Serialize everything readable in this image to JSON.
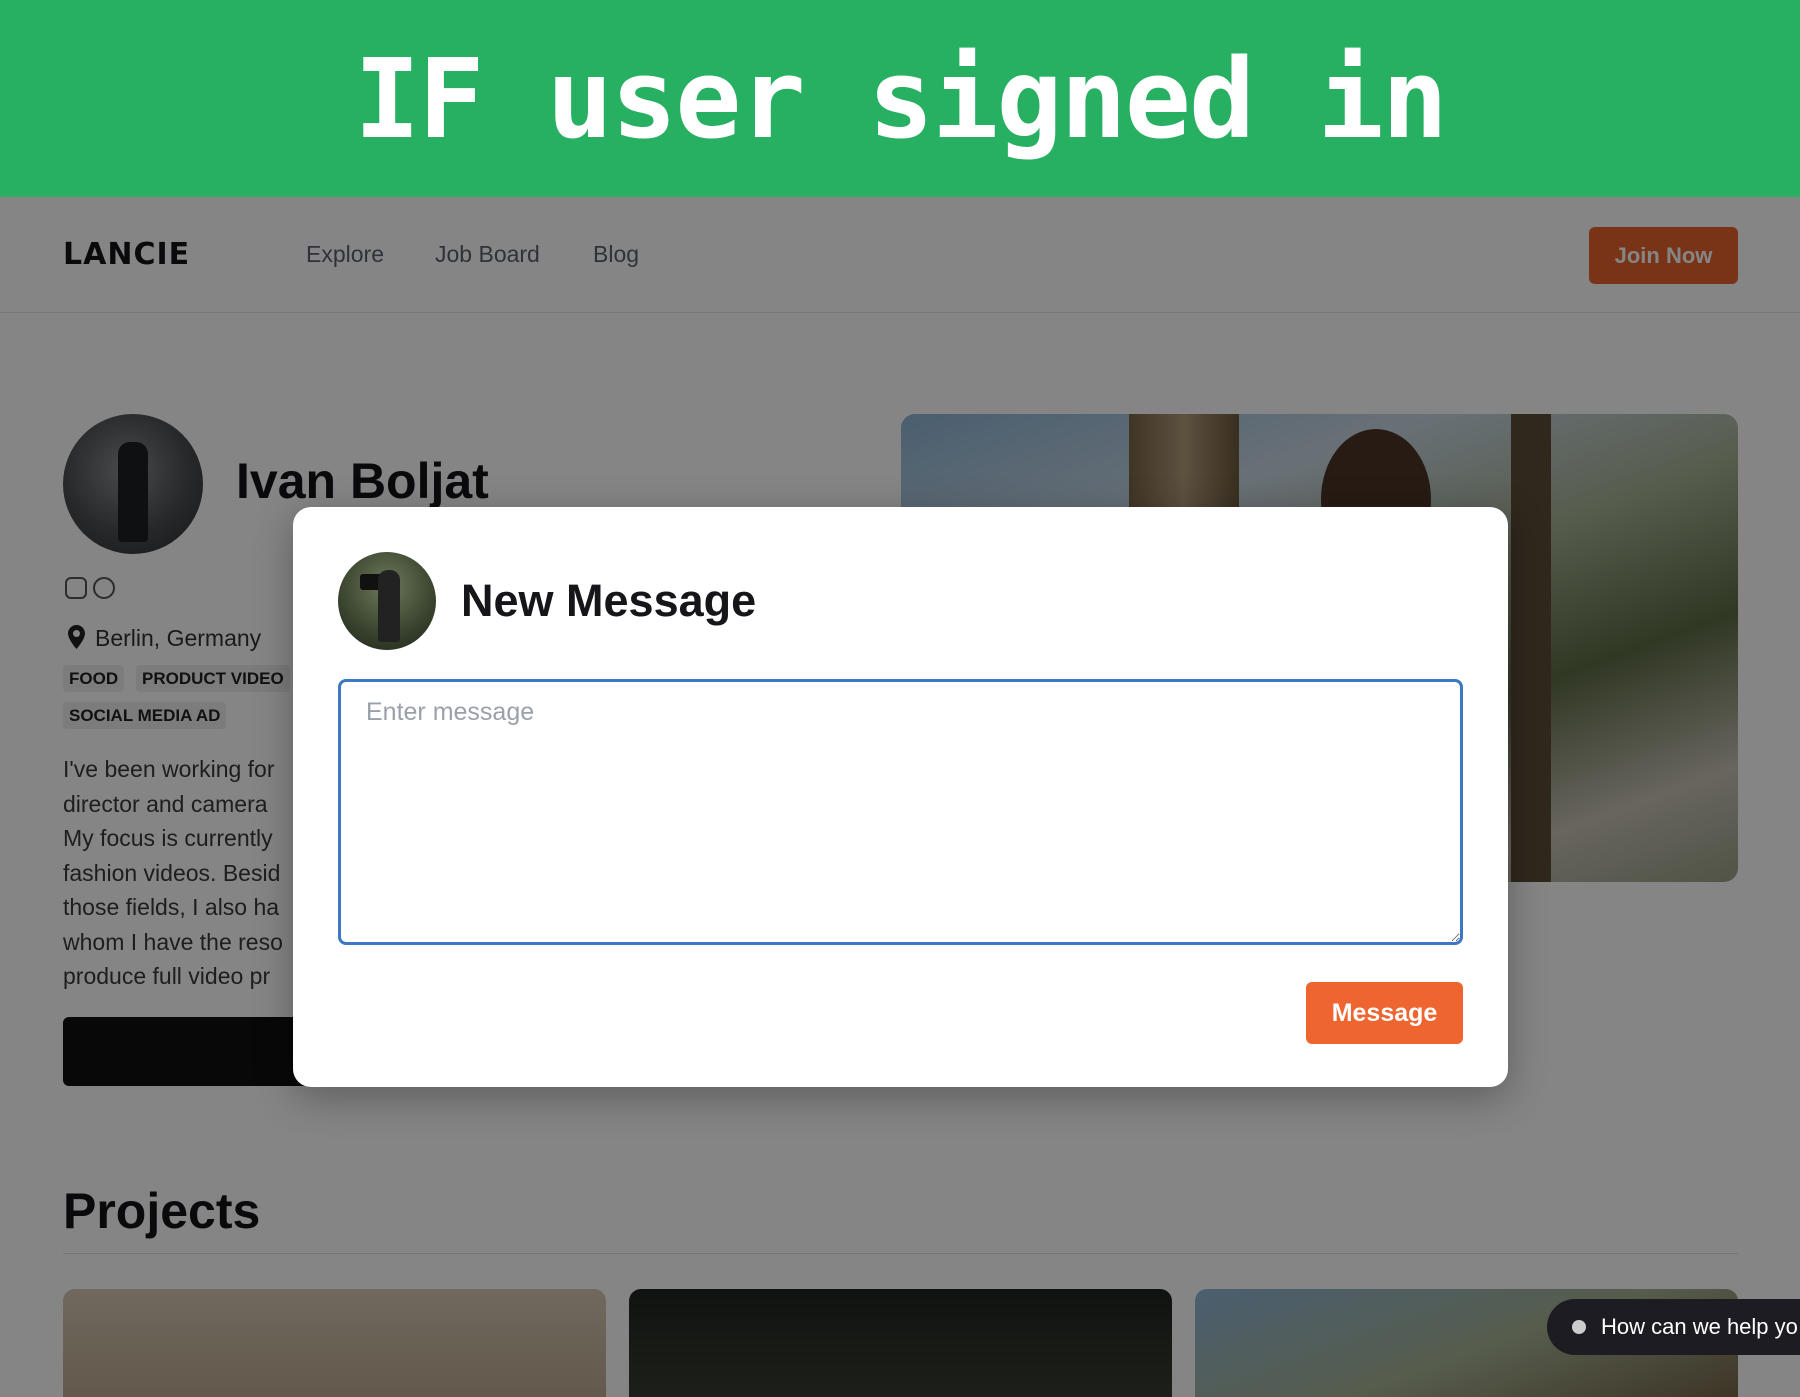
{
  "banner": {
    "text": "IF user signed in"
  },
  "nav": {
    "logo": "LANCIE",
    "links": [
      "Explore",
      "Job Board",
      "Blog"
    ],
    "join_label": "Join Now"
  },
  "profile": {
    "name": "Ivan Boljat",
    "social_icons": [
      "instagram-icon",
      "globe-icon"
    ],
    "location": "Berlin, Germany",
    "tags": [
      "FOOD",
      "PRODUCT VIDEO",
      "SOCIAL MEDIA AD"
    ],
    "bio_lines": [
      "I've been working for",
      "director and camera",
      "My focus is currently",
      "fashion videos. Besid",
      "those fields, I also ha",
      "whom I have the reso",
      "produce full video pr"
    ]
  },
  "projects": {
    "title": "Projects"
  },
  "help_chip": {
    "text": "How can we help yo"
  },
  "modal": {
    "title": "New Message",
    "input_placeholder": "Enter message",
    "input_value": "",
    "submit_label": "Message"
  },
  "colors": {
    "banner": "#28b062",
    "accent": "#ef6530",
    "input_focus": "#3c78c6"
  }
}
